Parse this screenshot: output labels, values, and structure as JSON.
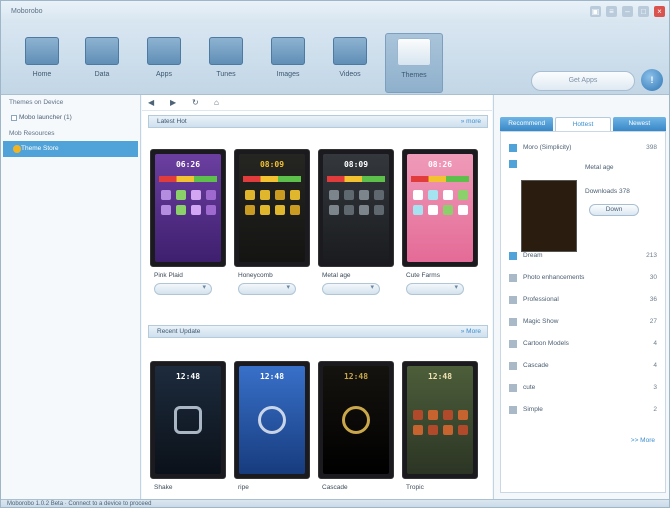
{
  "app": {
    "title": "Moborobo"
  },
  "window_controls": [
    "▣",
    "≡",
    "–",
    "□",
    "×"
  ],
  "toolbar": {
    "nav": [
      {
        "label": "Home",
        "icon": "home-icon"
      },
      {
        "label": "Data",
        "icon": "data-icon"
      },
      {
        "label": "Apps",
        "icon": "apps-icon"
      },
      {
        "label": "Tunes",
        "icon": "tunes-icon"
      },
      {
        "label": "Images",
        "icon": "images-icon"
      },
      {
        "label": "Videos",
        "icon": "videos-icon"
      },
      {
        "label": "Themes",
        "icon": "themes-icon",
        "active": true
      }
    ],
    "search_placeholder": "Get Apps",
    "help_label": "!"
  },
  "sidebar": {
    "heading1": "Themes on Device",
    "device_item": "Mobo launcher (1)",
    "heading2": "Mob Resources",
    "selected_item": "Theme Store"
  },
  "main": {
    "tool_icons": [
      "◀",
      "▶",
      "↻",
      "⌂"
    ],
    "section1": {
      "title": "Latest Hot",
      "more": "» more"
    },
    "section2": {
      "title": "Recent Update",
      "more": "» More"
    },
    "row1": [
      {
        "name": "Pink Plaid"
      },
      {
        "name": "Honeycomb"
      },
      {
        "name": "Metal age"
      },
      {
        "name": "Cute Farms"
      }
    ],
    "row2": [
      {
        "name": "Shake"
      },
      {
        "name": "ripe"
      },
      {
        "name": "Cascade"
      },
      {
        "name": "Tropic"
      }
    ]
  },
  "right_panel": {
    "tabs": [
      "Recommend",
      "Hottest",
      "Newest"
    ],
    "top_item": {
      "label": "Moro (Simplicity)",
      "count": "398"
    },
    "detail": {
      "name": "Metal age",
      "downloads": "Downloads 378",
      "button": "Down"
    },
    "categories": [
      {
        "label": "Dream",
        "count": "213",
        "color": "#4fa3d8"
      },
      {
        "label": "Photo enhancements",
        "count": "30",
        "color": "#a9b9c7"
      },
      {
        "label": "Professional",
        "count": "36",
        "color": "#a9b9c7"
      },
      {
        "label": "Magic Show",
        "count": "27",
        "color": "#a9b9c7"
      },
      {
        "label": "Cartoon Models",
        "count": "4",
        "color": "#a9b9c7"
      },
      {
        "label": "Cascade",
        "count": "4",
        "color": "#a9b9c7"
      },
      {
        "label": "cute",
        "count": "3",
        "color": "#a9b9c7"
      },
      {
        "label": "Simple",
        "count": "2",
        "color": "#a9b9c7"
      }
    ],
    "more": ">> More"
  },
  "statusbar": {
    "text": "Moborobo 1.0.2 Beta · Connect to a device to proceed"
  }
}
